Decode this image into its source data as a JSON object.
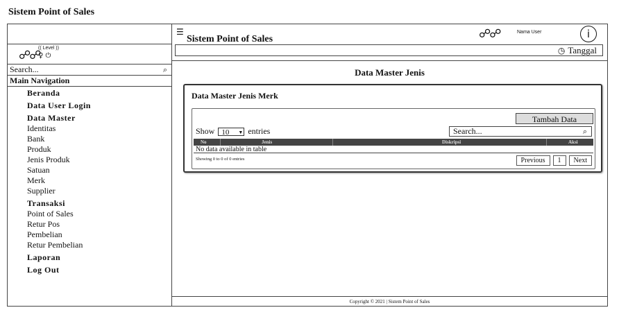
{
  "app": {
    "title": "Sistem Point of Sales"
  },
  "sidebar": {
    "level": "(( Level ))",
    "search_placeholder": "Search...",
    "main_nav_label": "Main Navigation",
    "items": [
      {
        "label": "Beranda",
        "heading": true
      },
      {
        "label": "Data User Login",
        "heading": true
      },
      {
        "label": "Data Master",
        "heading": true
      },
      {
        "label": "Identitas",
        "heading": false
      },
      {
        "label": "Bank",
        "heading": false
      },
      {
        "label": "Produk",
        "heading": false
      },
      {
        "label": "Jenis Produk",
        "heading": false
      },
      {
        "label": "Satuan",
        "heading": false
      },
      {
        "label": "Merk",
        "heading": false
      },
      {
        "label": "Supplier",
        "heading": false
      },
      {
        "label": "Transaksi",
        "heading": true
      },
      {
        "label": "Point of Sales",
        "heading": false
      },
      {
        "label": "Retur Pos",
        "heading": false
      },
      {
        "label": "Pembelian",
        "heading": false
      },
      {
        "label": "Retur Pembelian",
        "heading": false
      },
      {
        "label": "Laporan",
        "heading": true
      },
      {
        "label": "Log Out",
        "heading": true
      }
    ]
  },
  "header": {
    "title": "Sistem Point of Sales",
    "user_label": "Nama User",
    "info_glyph": "i",
    "date_label": "Tanggal"
  },
  "page": {
    "title": "Data Master Jenis",
    "card_title": "Data Master Jenis Merk",
    "add_button": "Tambah Data",
    "show_prefix": "Show",
    "entries_value": "10",
    "show_suffix": "entries",
    "search_placeholder": "Search...",
    "columns": [
      "No",
      "Jenis",
      "Diskripsi",
      "Aksi"
    ],
    "empty_message": "No data available in table",
    "showing_text": "Showing 0 to 0 of 0 entries",
    "pagination": [
      "Previous",
      "1",
      "Next"
    ]
  },
  "footer": {
    "text": "Copyright © 2021 | Sistem Point of Sales"
  },
  "icons": [
    "users-icon",
    "user-icon",
    "power-icon",
    "search-icon",
    "menu-icon",
    "info-icon",
    "clock-icon",
    "caret-down-icon"
  ]
}
